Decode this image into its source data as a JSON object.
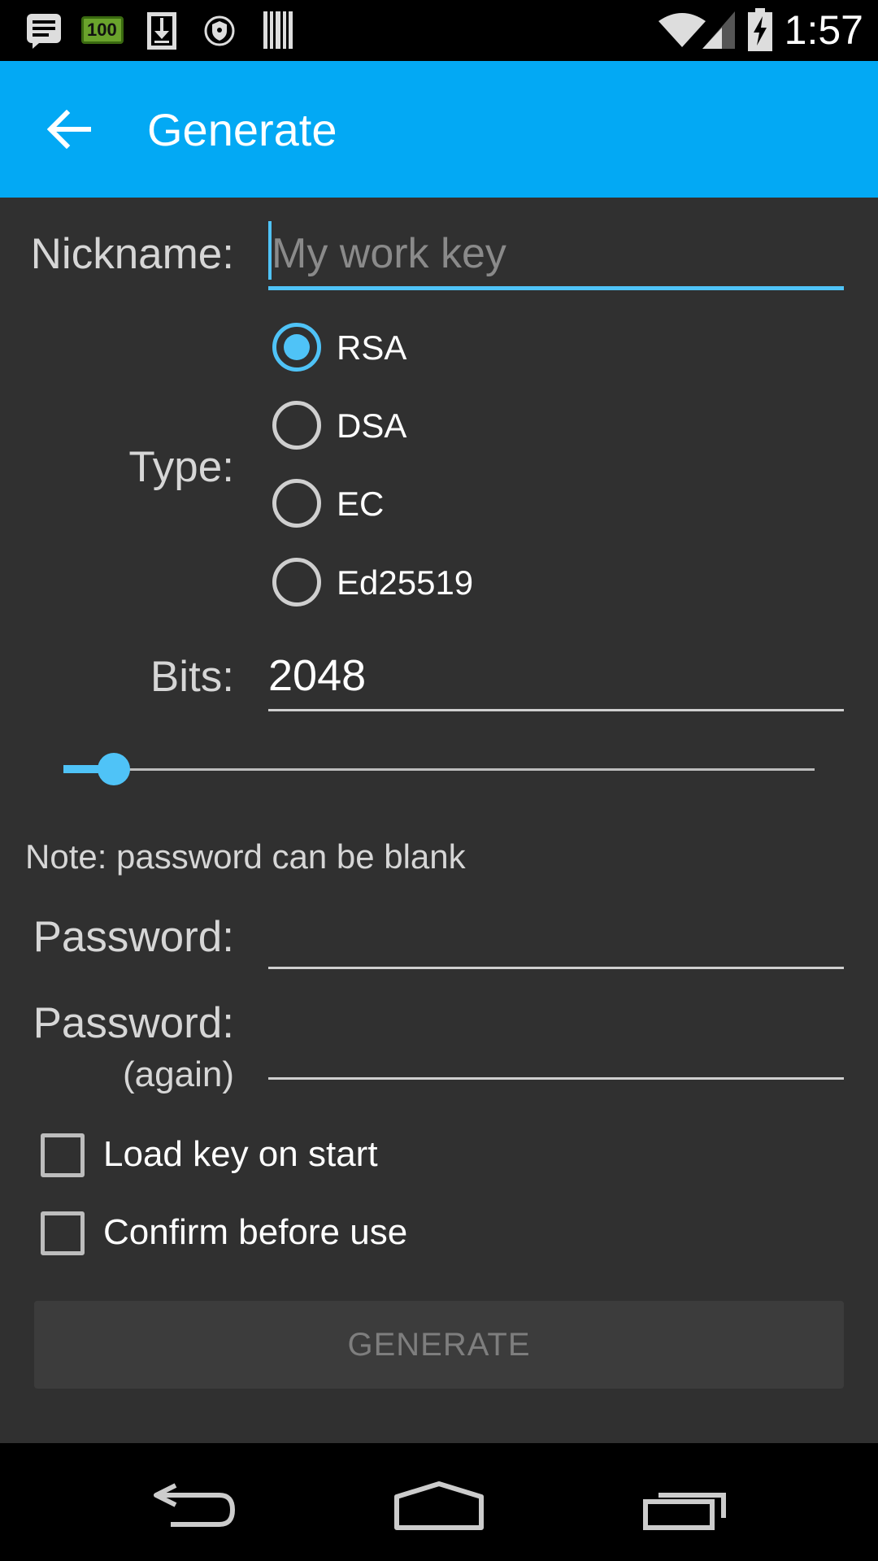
{
  "status_bar": {
    "time": "1:57",
    "battery_badge": "100",
    "icons": [
      "notes-icon",
      "battery-badge-icon",
      "download-icon",
      "vpn-shield-icon",
      "barcode-icon",
      "wifi-icon",
      "signal-icon",
      "battery-charging-icon"
    ]
  },
  "appbar": {
    "title": "Generate",
    "back_icon": "arrow-back-icon",
    "color": "#03a9f4"
  },
  "form": {
    "nickname_label": "Nickname:",
    "nickname_placeholder": "My work key",
    "nickname_value": "",
    "type_label": "Type:",
    "type_options": [
      {
        "label": "RSA",
        "checked": true
      },
      {
        "label": "DSA",
        "checked": false
      },
      {
        "label": "EC",
        "checked": false
      },
      {
        "label": "Ed25519",
        "checked": false
      }
    ],
    "bits_label": "Bits:",
    "bits_value": "2048",
    "bits_slider_fraction": 0.06,
    "note": "Note: password can be blank",
    "password_label": "Password:",
    "password_again_label": "Password:",
    "password_again_sub": "(again)",
    "checkboxes": [
      {
        "label": "Load key on start",
        "checked": false
      },
      {
        "label": "Confirm before use",
        "checked": false
      }
    ],
    "generate_button": "GENERATE"
  },
  "colors": {
    "accent": "#4fc3f7",
    "background": "#303030"
  },
  "nav_bar": {
    "icons": [
      "nav-back-icon",
      "nav-home-icon",
      "nav-recents-icon"
    ]
  }
}
